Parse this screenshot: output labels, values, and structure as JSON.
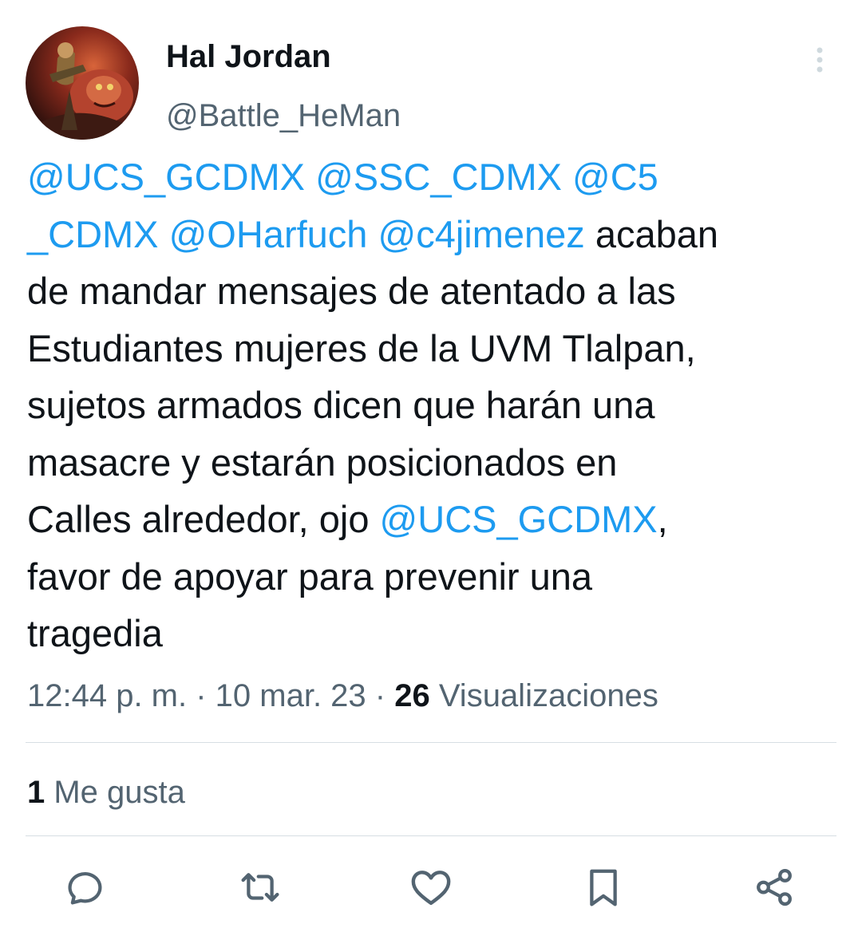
{
  "author": {
    "display_name": "Hal Jordan",
    "handle": "@Battle_HeMan",
    "avatar_icon": "avatar-image"
  },
  "tweet": {
    "segments": [
      {
        "text": "@UCS_GCDMX",
        "type": "mention"
      },
      {
        "text": " ",
        "type": "text"
      },
      {
        "text": "@SSC_CDMX",
        "type": "mention"
      },
      {
        "text": " ",
        "type": "text"
      },
      {
        "text": "@C5\n_CDMX",
        "type": "mention"
      },
      {
        "text": " ",
        "type": "text"
      },
      {
        "text": "@OHarfuch",
        "type": "mention"
      },
      {
        "text": " ",
        "type": "text"
      },
      {
        "text": "@c4jimenez",
        "type": "mention"
      },
      {
        "text": " acaban\nde mandar mensajes de atentado a las\nEstudiantes mujeres de la UVM Tlalpan,\nsujetos armados dicen que harán una\nmasacre y estarán posicionados en\nCalles alrededor, ojo ",
        "type": "text"
      },
      {
        "text": "@UCS_GCDMX",
        "type": "mention"
      },
      {
        "text": ",\nfavor de apoyar para prevenir una\ntragedia",
        "type": "text"
      }
    ]
  },
  "meta": {
    "time": "12:44 p. m.",
    "separator": " · ",
    "date": "10 mar. 23",
    "views_count": "26",
    "views_label": " Visualizaciones"
  },
  "engagement": {
    "likes_count": "1",
    "likes_label": " Me gusta"
  },
  "actions": [
    {
      "name": "reply",
      "icon": "reply-icon"
    },
    {
      "name": "retweet",
      "icon": "retweet-icon"
    },
    {
      "name": "like",
      "icon": "heart-icon"
    },
    {
      "name": "bookmark",
      "icon": "bookmark-icon"
    },
    {
      "name": "share",
      "icon": "share-icon"
    }
  ],
  "colors": {
    "text": "#0f1419",
    "secondary": "#536471",
    "link": "#1d9bf0",
    "divider": "#d7dee3"
  }
}
